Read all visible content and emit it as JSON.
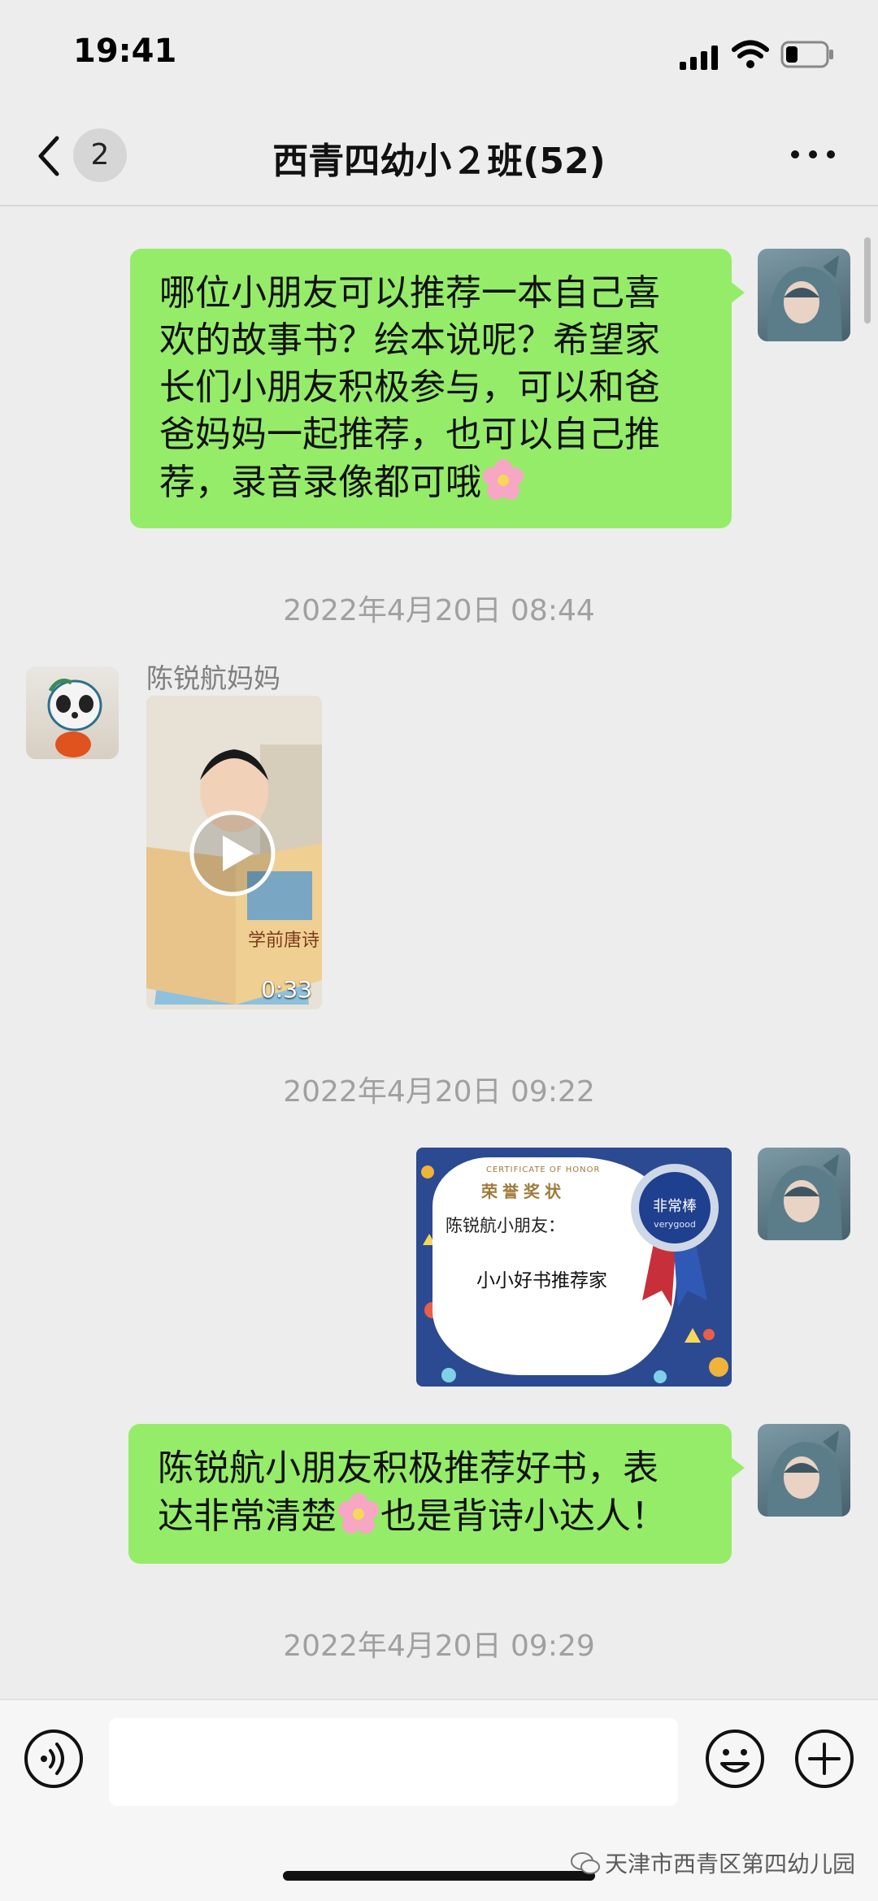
{
  "status_bar": {
    "time": "19:41"
  },
  "nav": {
    "unread_count": "2",
    "title": "西青四幼小２班(52)"
  },
  "messages": {
    "m1_text": "哪位小朋友可以推荐一本自己喜\n欢的故事书？绘本说呢？希望家\n长们小朋友积极参与，可以和爸\n爸妈妈一起推荐，也可以自己推\n荐，录音录像都可哦",
    "ts1": "2022年4月20日 08:44",
    "sender_name": "陈锐航妈妈",
    "video_duration": "0:33",
    "video_book_title": "学前唐诗",
    "ts2": "2022年4月20日 09:22",
    "cert": {
      "english": "CERTIFICATE OF HONOR",
      "title": "荣誉奖状",
      "recipient": "陈锐航小朋友：",
      "award": "小小好书推荐家",
      "medal_cn": "非常棒",
      "medal_en": "verygood"
    },
    "m3_line1": "陈锐航小朋友积极推荐好书，表",
    "m3_line2_a": "达非常清楚",
    "m3_line2_b": "也是背诗小达人！",
    "ts3": "2022年4月20日 09:29"
  },
  "watermark": "天津市西青区第四幼儿园",
  "colors": {
    "bubble": "#95ec69",
    "background": "#ededed"
  },
  "icons": [
    "back-chevron-icon",
    "more-dots-icon",
    "voice-icon",
    "emoji-icon",
    "plus-icon",
    "play-icon",
    "flower-emoji-icon"
  ]
}
